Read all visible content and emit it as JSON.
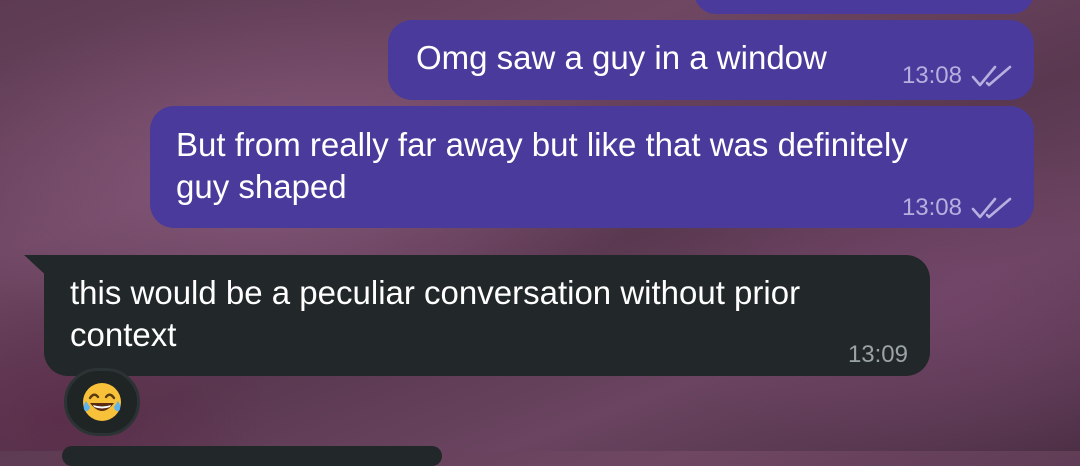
{
  "chat": {
    "messages": [
      {
        "direction": "outgoing",
        "text": "Omg saw a guy in a window",
        "time": "13:08",
        "status": "read-double-check-icon"
      },
      {
        "direction": "outgoing",
        "text": "But from really far away but like that was definitely\nguy shaped",
        "time": "13:08",
        "status": "read-double-check-icon"
      },
      {
        "direction": "incoming",
        "text": "this would be a peculiar conversation without prior\ncontext",
        "time": "13:09",
        "reaction": "tears-of-joy-emoji"
      }
    ]
  },
  "colors": {
    "outgoing_bubble": "#4a3a9b",
    "incoming_bubble": "#222829",
    "outgoing_meta": "#b6b0e0",
    "incoming_meta": "#9aa3a6",
    "emoji_yellow": "#f7c13a"
  }
}
